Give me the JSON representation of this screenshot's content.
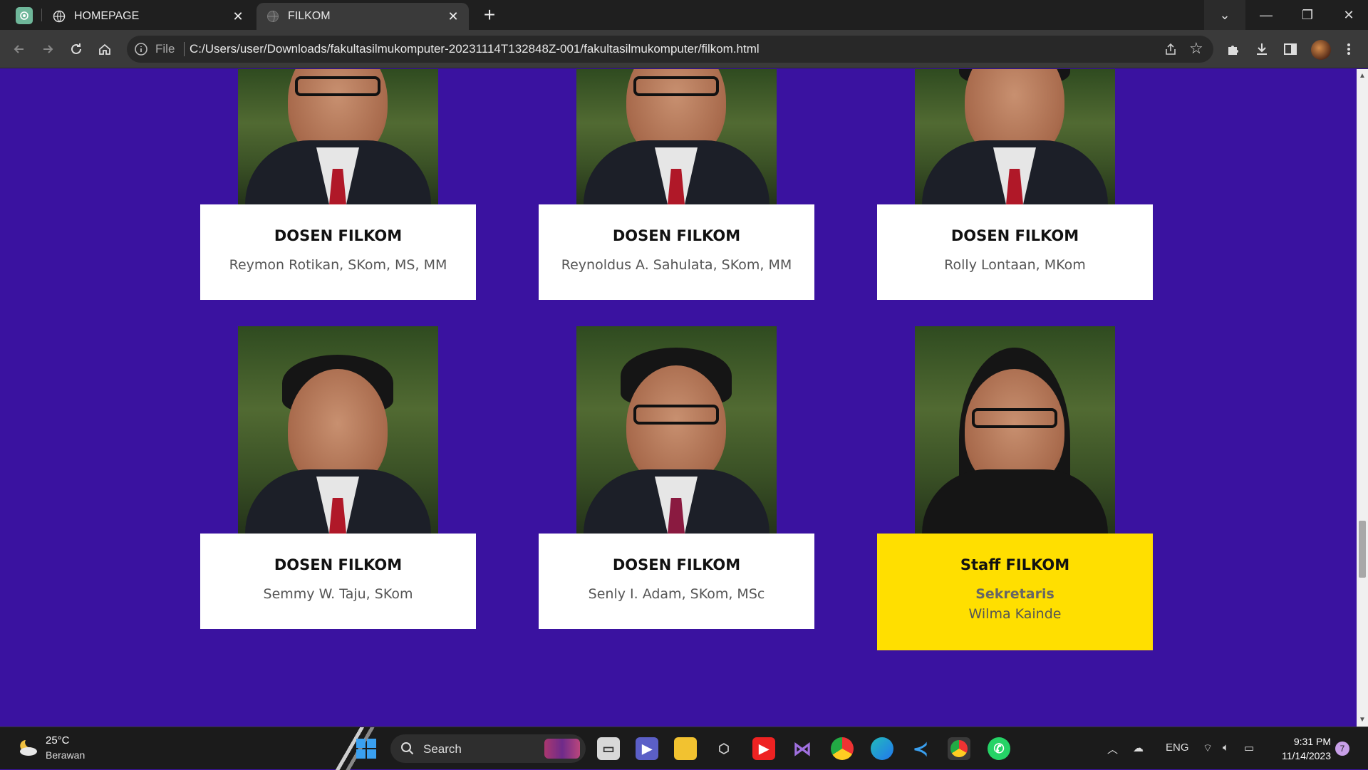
{
  "browser": {
    "tabs": [
      {
        "title": "HOMEPAGE",
        "active": false
      },
      {
        "title": "FILKOM",
        "active": true
      }
    ],
    "address": {
      "scheme_label": "File",
      "url": "C:/Users/user/Downloads/fakultasilmukomputer-20231114T132848Z-001/fakultasilmukomputer/filkom.html"
    }
  },
  "page": {
    "background": "#3a12a0",
    "cards": [
      {
        "title": "DOSEN FILKOM",
        "name": "Reymon Rotikan, SKom, MS, MM"
      },
      {
        "title": "DOSEN FILKOM",
        "name": "Reynoldus A. Sahulata, SKom, MM"
      },
      {
        "title": "DOSEN FILKOM",
        "name": "Rolly Lontaan, MKom"
      },
      {
        "title": "DOSEN FILKOM",
        "name": "Semmy W. Taju, SKom"
      },
      {
        "title": "DOSEN FILKOM",
        "name": "Senly I. Adam, SKom, MSc"
      },
      {
        "title": "Staff FILKOM",
        "role": "Sekretaris",
        "name": "Wilma Kainde",
        "highlight": "#ffdf00"
      }
    ]
  },
  "taskbar": {
    "weather": {
      "temp": "25°C",
      "condition": "Berawan"
    },
    "search_label": "Search",
    "language": "ENG",
    "time": "9:31 PM",
    "date": "11/14/2023",
    "notification_count": "7"
  }
}
